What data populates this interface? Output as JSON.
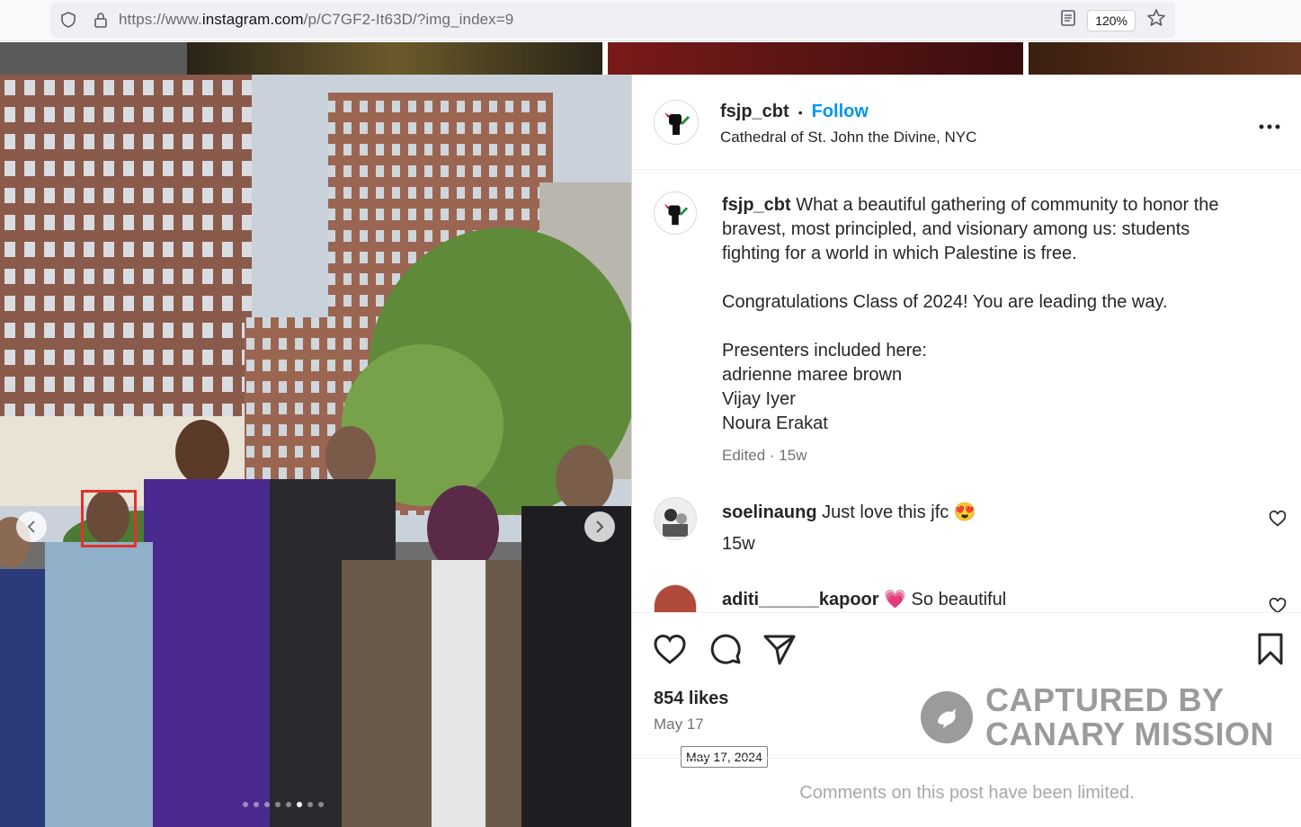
{
  "browser": {
    "url_prefix": "https://www.",
    "url_host": "instagram.com",
    "url_path": "/p/C7GF2-It63D/?img_index=9",
    "zoom": "120%"
  },
  "post": {
    "username": "fsjp_cbt",
    "separator": "•",
    "follow_label": "Follow",
    "location": "Cathedral of St. John the Divine, NYC",
    "more_label": "...",
    "caption_user": "fsjp_cbt",
    "caption_lines": [
      "What a beautiful gathering of community to honor the",
      "bravest, most principled, and visionary among us: students",
      "fighting for a world in which Palestine is free.",
      "",
      "Congratulations Class of 2024! You are leading the way.",
      "",
      "Presenters included here:",
      "adrienne maree brown",
      "Vijay Iyer",
      "Noura Erakat"
    ],
    "caption_meta": "Edited · 15w",
    "likes": "854 likes",
    "date": "May 17",
    "date_tooltip": "May 17, 2024",
    "comments_limited": "Comments on this post have been limited."
  },
  "comments": [
    {
      "user": "soelinaung",
      "text": "Just love this jfc 😍",
      "time": "15w"
    },
    {
      "user": "aditi______kapoor",
      "text": "💗 So beautiful",
      "time": ""
    }
  ],
  "watermark": {
    "line1": "CAPTURED BY",
    "line2": "CANARY MISSION"
  },
  "colors": {
    "follow": "#0095f6",
    "highlight_box": "#e4312b"
  }
}
